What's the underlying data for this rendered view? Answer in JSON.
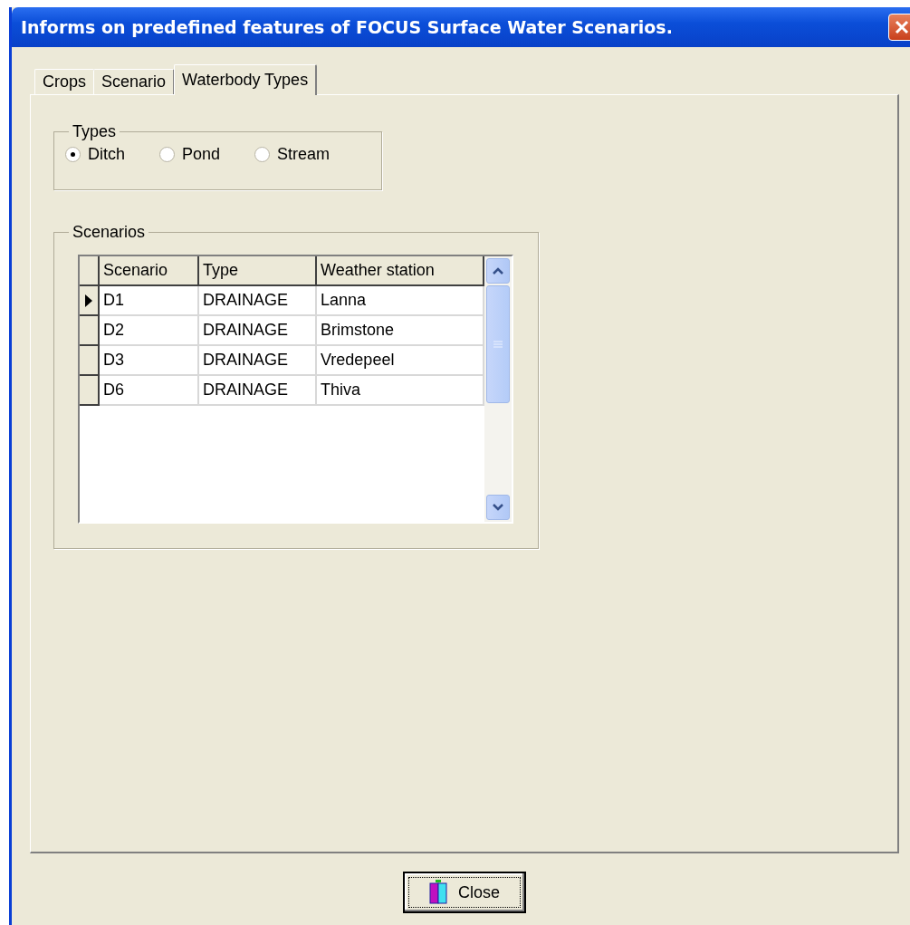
{
  "window": {
    "title": "Informs on predefined features of FOCUS Surface Water Scenarios."
  },
  "tabs": [
    {
      "label": "Crops",
      "selected": false
    },
    {
      "label": "Scenario",
      "selected": false
    },
    {
      "label": "Waterbody Types",
      "selected": true
    }
  ],
  "types": {
    "title": "Types",
    "options": [
      {
        "label": "Ditch",
        "selected": true
      },
      {
        "label": "Pond",
        "selected": false
      },
      {
        "label": "Stream",
        "selected": false
      }
    ]
  },
  "scenarios": {
    "title": "Scenarios",
    "columns": [
      "Scenario",
      "Type",
      "Weather station"
    ],
    "rows": [
      {
        "cells": [
          "D1",
          "DRAINAGE",
          "Lanna"
        ],
        "selected": true
      },
      {
        "cells": [
          "D2",
          "DRAINAGE",
          "Brimstone"
        ],
        "selected": false
      },
      {
        "cells": [
          "D3",
          "DRAINAGE",
          "Vredepeel"
        ],
        "selected": false
      },
      {
        "cells": [
          "D6",
          "DRAINAGE",
          "Thiva"
        ],
        "selected": false
      }
    ]
  },
  "buttons": [
    {
      "label": "Close"
    }
  ]
}
